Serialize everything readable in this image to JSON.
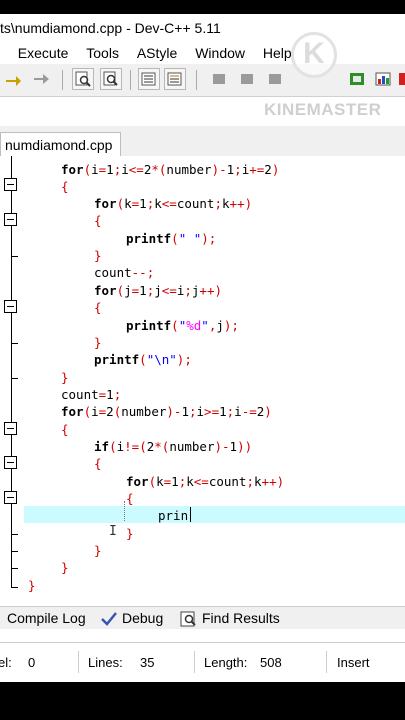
{
  "window": {
    "title": "ts\\numdiamond.cpp - Dev-C++ 5.11"
  },
  "menu": {
    "items": [
      "t",
      "Execute",
      "Tools",
      "AStyle",
      "Window",
      "Help"
    ]
  },
  "watermark": {
    "text": "KINEMASTER",
    "badge_letter": "K"
  },
  "editor": {
    "tab_label": "numdiamond.cpp",
    "code_lines": [
      "for(i=1;i<=2*(number)-1;i+=2)",
      "{",
      "for(k=1;k<=count;k++)",
      "{",
      "printf(\" \");",
      "}",
      "count--;",
      "for(j=1;j<=i;j++)",
      "{",
      "printf(\"%d\",j);",
      "}",
      "printf(\"\\n\");",
      "}",
      "count=1;",
      "for(i=2(number)-1;i>=1;i-=2)",
      "{",
      "if(i!=(2*(number)-1))",
      "{",
      "for(k=1;k<=count;k++)",
      "{",
      "prin",
      "}",
      "}",
      "}",
      "}"
    ]
  },
  "bottom_tabs": {
    "compile_log": "Compile Log",
    "debug": "Debug",
    "find_results": "Find Results"
  },
  "status": {
    "sel_label": "el:",
    "sel_value": "0",
    "lines_label": "Lines:",
    "lines_value": "35",
    "length_label": "Length:",
    "length_value": "508",
    "mode": "Insert"
  }
}
